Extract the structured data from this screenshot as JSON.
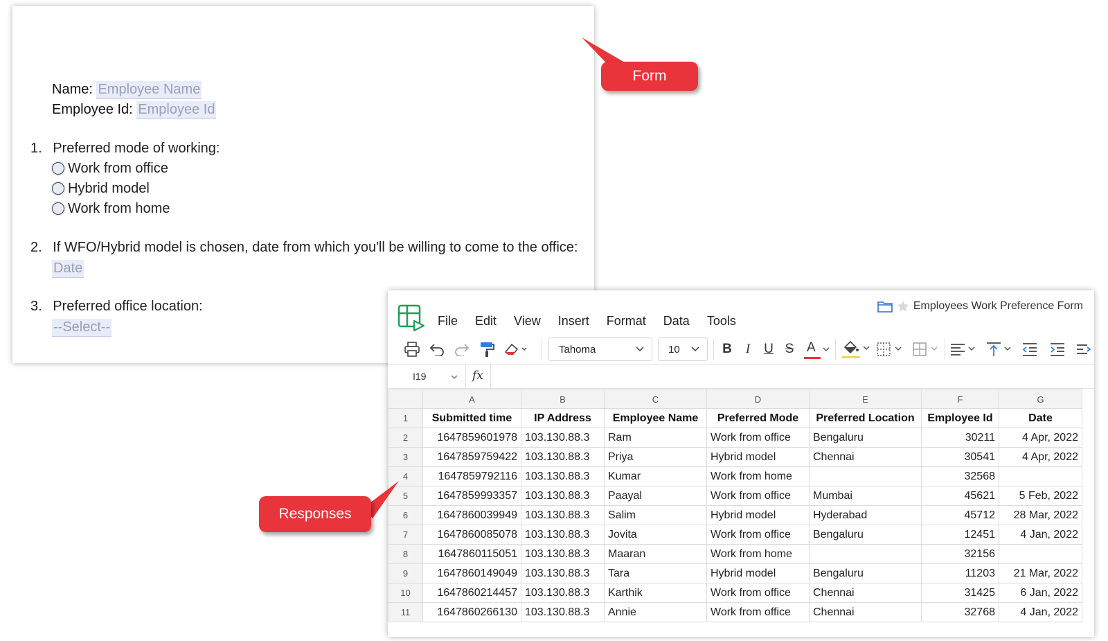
{
  "form": {
    "name_label": "Name:",
    "name_placeholder": "Employee Name",
    "empid_label": "Employee Id:",
    "empid_placeholder": "Employee Id",
    "q1_number": "1.",
    "q1_text": "Preferred mode of working:",
    "q1_options": [
      "Work from office",
      "Hybrid model",
      "Work from home"
    ],
    "q2_number": "2.",
    "q2_text": "If WFO/Hybrid model is chosen, date from which you'll be willing to come to the office:",
    "q2_placeholder": "Date",
    "q3_number": "3.",
    "q3_text": "Preferred office location:",
    "q3_placeholder": "--Select--"
  },
  "callouts": {
    "form": "Form",
    "responses": "Responses"
  },
  "colors": {
    "callout": "#e8343a",
    "placeholder_bg": "#e8ebf8",
    "logo_green": "#1e9e57"
  },
  "sheet": {
    "doc_title": "Employees Work Preference Form",
    "menu": [
      "File",
      "Edit",
      "View",
      "Insert",
      "Format",
      "Data",
      "Tools"
    ],
    "font_name": "Tahoma",
    "font_size": "10",
    "cell_ref": "I19",
    "fx_label": "fx",
    "toolbar_icons": [
      "print-icon",
      "undo-icon",
      "redo-icon",
      "paint-format-icon",
      "clear-format-icon",
      "bold-icon",
      "italic-icon",
      "underline-icon",
      "strikethrough-icon",
      "text-color-icon",
      "fill-color-icon",
      "borders-icon",
      "merge-cells-icon",
      "align-left-icon",
      "vertical-align-icon",
      "decrease-indent-icon",
      "increase-indent-icon",
      "wrap-text-icon"
    ],
    "bold_glyph": "B",
    "italic_glyph": "I",
    "underline_glyph": "U",
    "strike_glyph": "S",
    "textcolor_glyph": "A",
    "columns": [
      "A",
      "B",
      "C",
      "D",
      "E",
      "F",
      "G"
    ],
    "headers": [
      "Submitted time",
      "IP Address",
      "Employee Name",
      "Preferred Mode",
      "Preferred Location",
      "Employee Id",
      "Date"
    ],
    "rows": [
      [
        "1647859601978",
        "103.130.88.3",
        "Ram",
        "Work from office",
        "Bengaluru",
        "30211",
        "4 Apr, 2022"
      ],
      [
        "1647859759422",
        "103.130.88.3",
        "Priya",
        "Hybrid model",
        "Chennai",
        "30541",
        "4 Apr, 2022"
      ],
      [
        "1647859792116",
        "103.130.88.3",
        "Kumar",
        "Work from home",
        "",
        "32568",
        ""
      ],
      [
        "1647859993357",
        "103.130.88.3",
        "Paayal",
        "Work from office",
        "Mumbai",
        "45621",
        "5 Feb, 2022"
      ],
      [
        "1647860039949",
        "103.130.88.3",
        "Salim",
        "Hybrid model",
        "Hyderabad",
        "45712",
        "28 Mar, 2022"
      ],
      [
        "1647860085078",
        "103.130.88.3",
        "Jovita",
        "Work from office",
        "Bengaluru",
        "12451",
        "4 Jan, 2022"
      ],
      [
        "1647860115051",
        "103.130.88.3",
        "Maaran",
        "Work from home",
        "",
        "32156",
        ""
      ],
      [
        "1647860149049",
        "103.130.88.3",
        "Tara",
        "Hybrid model",
        "Bengaluru",
        "11203",
        "21 Mar, 2022"
      ],
      [
        "1647860214457",
        "103.130.88.3",
        "Karthik",
        "Work from office",
        "Chennai",
        "31425",
        "6 Jan, 2022"
      ],
      [
        "1647860266130",
        "103.130.88.3",
        "Annie",
        "Work from office",
        "Chennai",
        "32768",
        "4 Jan, 2022"
      ]
    ],
    "row_numbers": [
      "1",
      "2",
      "3",
      "4",
      "5",
      "6",
      "7",
      "8",
      "9",
      "10",
      "11"
    ]
  }
}
